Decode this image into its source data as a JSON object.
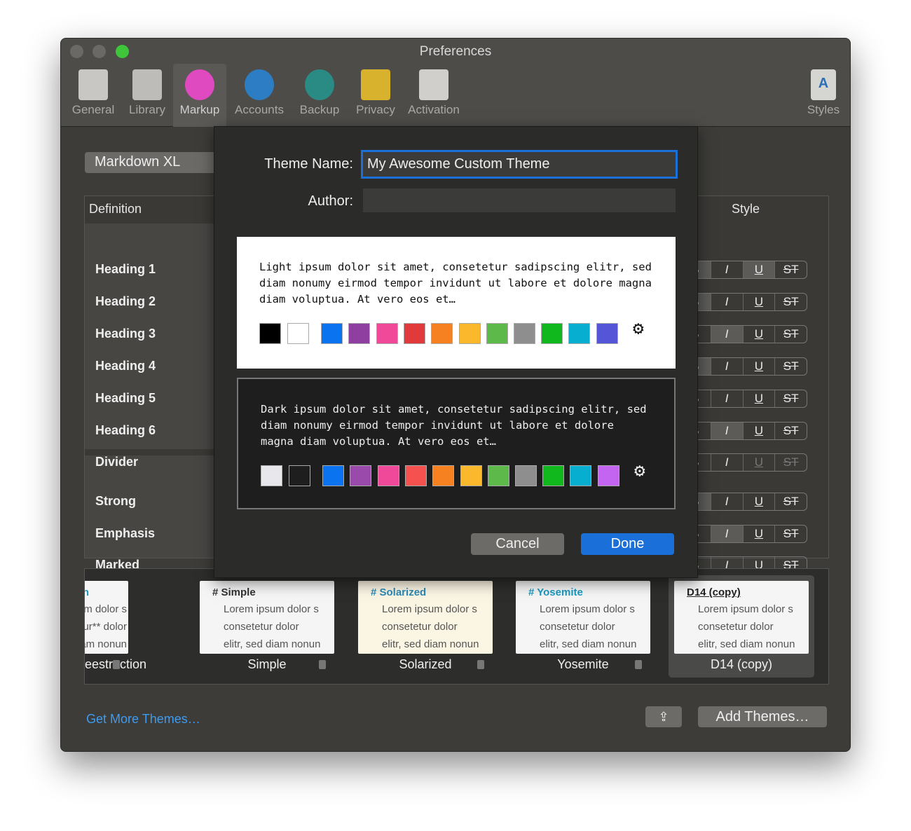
{
  "window": {
    "title": "Preferences",
    "traffic_lights": [
      "#6a6966",
      "#6a6966",
      "#3ec53a"
    ]
  },
  "toolbar": {
    "items": [
      {
        "label": "General",
        "icon": "switch-icon",
        "color": "#c8c7c3"
      },
      {
        "label": "Library",
        "icon": "library-icon",
        "color": "#bdbcb8"
      },
      {
        "label": "Markup",
        "icon": "color-wheel-icon",
        "color": "#e04ac0",
        "selected": true
      },
      {
        "label": "Accounts",
        "icon": "user-icon",
        "color": "#2d7dc4"
      },
      {
        "label": "Backup",
        "icon": "time-machine-icon",
        "color": "#2a8a84"
      },
      {
        "label": "Privacy",
        "icon": "lock-icon",
        "color": "#d8b22c"
      },
      {
        "label": "Activation",
        "icon": "certificate-icon",
        "color": "#d0cfcb"
      }
    ],
    "styles_label": "Styles"
  },
  "markup": {
    "selected_syntax": "Markdown XL",
    "definition_header": "Definition",
    "style_header": "Style",
    "rows": [
      {
        "label": "Heading 1",
        "on": [
          0,
          2
        ]
      },
      {
        "label": "Heading 2",
        "on": [
          0
        ]
      },
      {
        "label": "Heading 3",
        "on": [
          1
        ]
      },
      {
        "label": "Heading 4",
        "on": [
          0
        ]
      },
      {
        "label": "Heading 5",
        "on": []
      },
      {
        "label": "Heading 6",
        "on": [
          1
        ]
      },
      {
        "label": "Divider",
        "on": [],
        "disabled": [
          2,
          3
        ]
      },
      {
        "label": "Strong",
        "on": [
          0
        ]
      },
      {
        "label": "Emphasis",
        "on": [
          1
        ]
      },
      {
        "label": "Marked",
        "on": []
      }
    ],
    "style_buttons": [
      "B",
      "I",
      "U",
      "ST"
    ]
  },
  "themes": [
    {
      "heading": "estraction",
      "name": "eestraction",
      "lines": [
        "em ipsum dolor s",
        "nsetetur** dolor",
        ", sed diam nonun"
      ],
      "accent": "#1a9ac0",
      "locked": true
    },
    {
      "heading": "# Simple",
      "name": "Simple",
      "lines": [
        "Lorem ipsum dolor s",
        "consetetur dolor",
        "elitr, sed diam nonun"
      ],
      "accent": "#333",
      "locked": true
    },
    {
      "heading": "# Solarized",
      "name": "Solarized",
      "lines": [
        "Lorem ipsum dolor s",
        "consetetur dolor",
        "elitr, sed diam nonun"
      ],
      "accent": "#2b8ab5",
      "locked": true,
      "bg": "#fbf5e3"
    },
    {
      "heading": "# Yosemite",
      "name": "Yosemite",
      "lines": [
        "Lorem ipsum dolor s",
        "consetetur dolor",
        "elitr, sed diam nonun"
      ],
      "accent": "#1a9ac0",
      "locked": true
    },
    {
      "heading": "D14 (copy)",
      "name": "D14 (copy)",
      "lines": [
        "Lorem ipsum dolor s",
        "consetetur dolor",
        "elitr, sed diam nonun"
      ],
      "accent": "#222",
      "locked": false,
      "selected": true
    }
  ],
  "footer": {
    "get_more": "Get More Themes…",
    "add_themes": "Add Themes…"
  },
  "dialog": {
    "theme_name_label": "Theme Name:",
    "theme_name_value": "My Awesome Custom Theme",
    "author_label": "Author:",
    "author_value": "",
    "light_text": "Light ipsum dolor sit amet, consetetur sadipscing elitr, sed diam nonumy eirmod tempor invidunt ut labore et dolore magna diam voluptua. At vero eos et…",
    "dark_text": "Dark ipsum dolor sit amet, consetetur sadipscing elitr, sed diam nonumy eirmod tempor invidunt ut labore et dolore magna diam voluptua. At vero eos et…",
    "light_colors": [
      "#000000",
      "#ffffff",
      "#0a74f0",
      "#8e3fa0",
      "#f0499a",
      "#e03a3c",
      "#f58120",
      "#fbb82c",
      "#5db94a",
      "#8e8e8e",
      "#10b81e",
      "#08aed0",
      "#5555d8"
    ],
    "dark_colors": [
      "#e8e8ec",
      "#1e1e1e",
      "#0a74f0",
      "#9a4aaa",
      "#f0499a",
      "#f5524f",
      "#f58120",
      "#fbb82c",
      "#5db94a",
      "#8e8e8e",
      "#10b81e",
      "#08aed0",
      "#c465f2"
    ],
    "cancel": "Cancel",
    "done": "Done",
    "accent": "#1a6fd9"
  }
}
